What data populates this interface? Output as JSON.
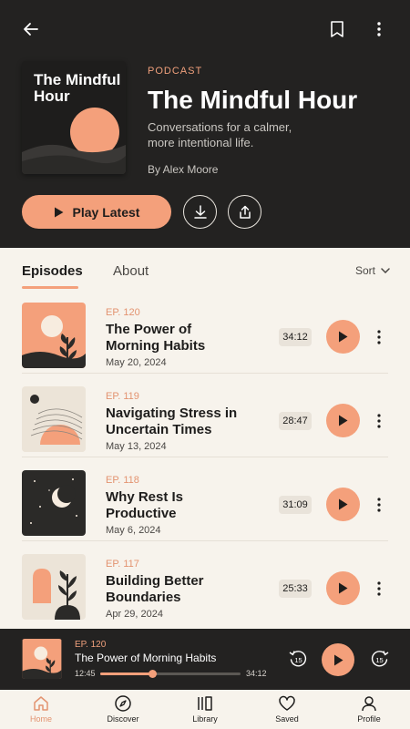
{
  "header": {
    "kicker": "PODCAST",
    "title": "The Mindful Hour",
    "description": "Conversations for a calmer, more intentional life.",
    "author": "By Alex Moore",
    "cover_title": "The Mindful Hour",
    "play_latest_label": "Play Latest"
  },
  "tabs": {
    "episodes": "Episodes",
    "about": "About",
    "sort": "Sort"
  },
  "episodes": [
    {
      "number": "EP. 120",
      "title": "The Power of Morning Habits",
      "date": "May 20, 2024",
      "duration": "34:12"
    },
    {
      "number": "EP. 119",
      "title": "Navigating Stress in Uncertain Times",
      "date": "May 13, 2024",
      "duration": "28:47"
    },
    {
      "number": "EP. 118",
      "title": "Why Rest Is Productive",
      "date": "May 6, 2024",
      "duration": "31:09"
    },
    {
      "number": "EP. 117",
      "title": "Building Better Boundaries",
      "date": "Apr 29, 2024",
      "duration": "25:33"
    }
  ],
  "player": {
    "episode": "EP. 120",
    "title": "The Power of Morning Habits",
    "elapsed": "12:45",
    "total": "34:12",
    "progress": 0.37,
    "skip_back": "15",
    "skip_forward": "15"
  },
  "nav": [
    {
      "label": "Home",
      "icon": "home-icon",
      "active": true
    },
    {
      "label": "Discover",
      "icon": "compass-icon",
      "active": false
    },
    {
      "label": "Library",
      "icon": "library-icon",
      "active": false
    },
    {
      "label": "Saved",
      "icon": "heart-icon",
      "active": false
    },
    {
      "label": "Profile",
      "icon": "user-icon",
      "active": false
    }
  ],
  "colors": {
    "accent": "#f4a07b",
    "dark": "#232221",
    "background": "#f7f3ec"
  }
}
